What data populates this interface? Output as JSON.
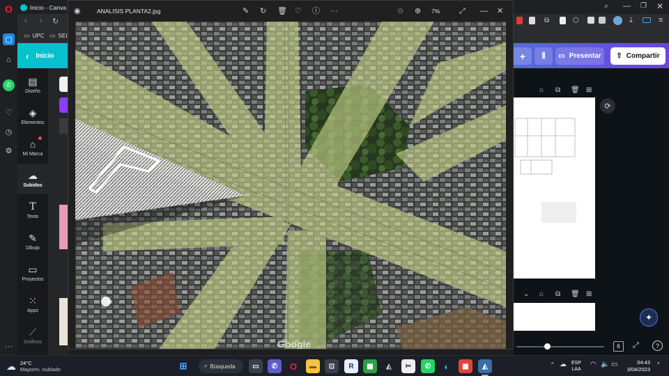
{
  "opera_sidebar": {
    "icons": [
      "opera-logo-icon",
      "extensions-icon",
      "home-icon",
      "whatsapp-icon",
      "heart-icon",
      "history-icon",
      "settings-icon",
      "more-icon"
    ]
  },
  "browser": {
    "tab_title": "Inicio - Canva",
    "bookmarks": [
      {
        "label": "UPC",
        "icon": "folder-icon"
      },
      {
        "label": "SEI",
        "icon": "folder-icon"
      }
    ]
  },
  "canva": {
    "home_label": "Inicio",
    "rail": [
      {
        "label": "Diseño",
        "icon": "layout-icon"
      },
      {
        "label": "Elementos",
        "icon": "shapes-icon"
      },
      {
        "label": "Mi Marca",
        "icon": "brand-icon"
      },
      {
        "label": "Subidos",
        "icon": "cloud-upload-icon",
        "active": true
      },
      {
        "label": "Texto",
        "icon": "text-icon"
      },
      {
        "label": "Dibujo",
        "icon": "draw-icon"
      },
      {
        "label": "Proyectos",
        "icon": "folder-icon"
      },
      {
        "label": "Apps",
        "icon": "apps-icon"
      },
      {
        "label": "Gráficos",
        "icon": "charts-icon"
      }
    ],
    "present_label": "Presentar",
    "share_label": "Compartir",
    "page_number": "6"
  },
  "photos": {
    "filename": "ANALISIS PLANTA2.jpg",
    "zoom": "7%",
    "watermark": "Google"
  },
  "taskbar": {
    "weather_temp": "24°C",
    "weather_desc": "Mayorm. nublado",
    "search_label": "Búsqueda",
    "lang_line1": "ESP",
    "lang_line2": "LAA",
    "time": "04:43",
    "date": "3/04/2023"
  },
  "colors": {
    "canva_teal": "#00c4cc",
    "canva_purple": "#6b43e2",
    "opera_red": "#ff1b2d",
    "road_overlay": "#c8d48a"
  }
}
